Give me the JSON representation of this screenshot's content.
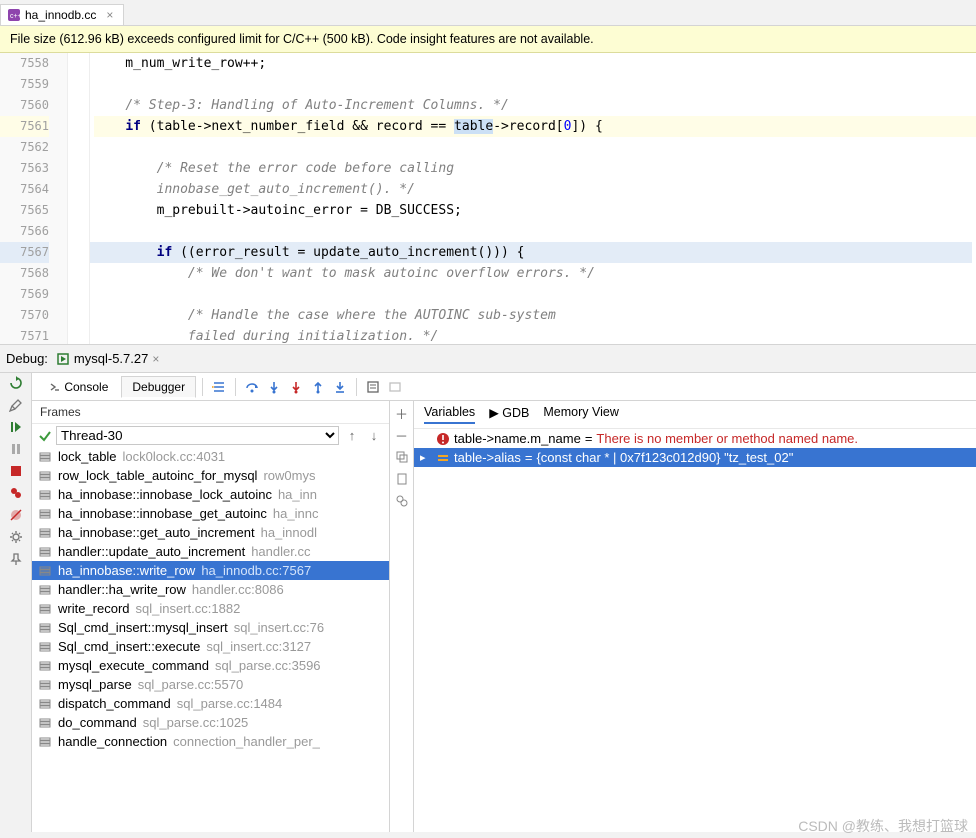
{
  "tab": {
    "filename": "ha_innodb.cc"
  },
  "banner": {
    "text": "File size (612.96 kB) exceeds configured limit for C/C++ (500 kB). Code insight features are not available."
  },
  "editor": {
    "lines": [
      {
        "n": 7558,
        "html": "    m_num_write_row++;"
      },
      {
        "n": 7559,
        "html": ""
      },
      {
        "n": 7560,
        "html": "    <span class='cmt'>/* Step-3: Handling of Auto-Increment Columns. */</span>"
      },
      {
        "n": 7561,
        "html": "    <span class='kw'>if</span> (table-&gt;next_number_field &amp;&amp; record == <span class='sel'>table</span>-&gt;record[<span class='num'>0</span>]) {",
        "cls": "hl-line"
      },
      {
        "n": 7562,
        "html": ""
      },
      {
        "n": 7563,
        "html": "        <span class='cmt'>/* Reset the error code before calling</span>"
      },
      {
        "n": 7564,
        "html": "        <span class='cmt'>innobase_get_auto_increment(). */</span>"
      },
      {
        "n": 7565,
        "html": "        m_prebuilt-&gt;autoinc_error = DB_SUCCESS;"
      },
      {
        "n": 7566,
        "html": ""
      },
      {
        "n": 7567,
        "html": "        <span class='kw'>if</span> ((error_result = update_auto_increment())) {",
        "cls": "hl-full"
      },
      {
        "n": 7568,
        "html": "            <span class='cmt'>/* We don't want to mask autoinc overflow errors. */</span>"
      },
      {
        "n": 7569,
        "html": ""
      },
      {
        "n": 7570,
        "html": "            <span class='cmt'>/* Handle the case where the AUTOINC sub-system</span>"
      },
      {
        "n": 7571,
        "html": "            <span class='cmt'>failed during initialization. */</span>"
      }
    ]
  },
  "debug": {
    "label": "Debug:",
    "config": "mysql-5.7.27",
    "tabs": {
      "console": "Console",
      "debugger": "Debugger"
    },
    "frames_hdr": "Frames",
    "thread": "Thread-30",
    "frames": [
      {
        "fn": "lock_table",
        "loc": "lock0lock.cc:4031"
      },
      {
        "fn": "row_lock_table_autoinc_for_mysql",
        "loc": "row0mys"
      },
      {
        "fn": "ha_innobase::innobase_lock_autoinc",
        "loc": "ha_inn"
      },
      {
        "fn": "ha_innobase::innobase_get_autoinc",
        "loc": "ha_innc"
      },
      {
        "fn": "ha_innobase::get_auto_increment",
        "loc": "ha_innodl"
      },
      {
        "fn": "handler::update_auto_increment",
        "loc": "handler.cc"
      },
      {
        "fn": "ha_innobase::write_row",
        "loc": "ha_innodb.cc:7567",
        "sel": true
      },
      {
        "fn": "handler::ha_write_row",
        "loc": "handler.cc:8086"
      },
      {
        "fn": "write_record",
        "loc": "sql_insert.cc:1882"
      },
      {
        "fn": "Sql_cmd_insert::mysql_insert",
        "loc": "sql_insert.cc:76"
      },
      {
        "fn": "Sql_cmd_insert::execute",
        "loc": "sql_insert.cc:3127"
      },
      {
        "fn": "mysql_execute_command",
        "loc": "sql_parse.cc:3596"
      },
      {
        "fn": "mysql_parse",
        "loc": "sql_parse.cc:5570"
      },
      {
        "fn": "dispatch_command",
        "loc": "sql_parse.cc:1484"
      },
      {
        "fn": "do_command",
        "loc": "sql_parse.cc:1025"
      },
      {
        "fn": "handle_connection",
        "loc": "connection_handler_per_"
      }
    ],
    "vars_tabs": {
      "variables": "Variables",
      "gdb": "GDB",
      "memory": "Memory View"
    },
    "watches": [
      {
        "type": "error",
        "expr": "table->name.m_name",
        "eq": "=",
        "msg": "There is no member or method named name."
      },
      {
        "type": "val",
        "expr": "table->alias",
        "eq": "=",
        "val": "{const char * | 0x7f123c012d90} \"tz_test_02\"",
        "sel": true
      }
    ]
  },
  "footer": "CSDN @教练、我想打篮球"
}
